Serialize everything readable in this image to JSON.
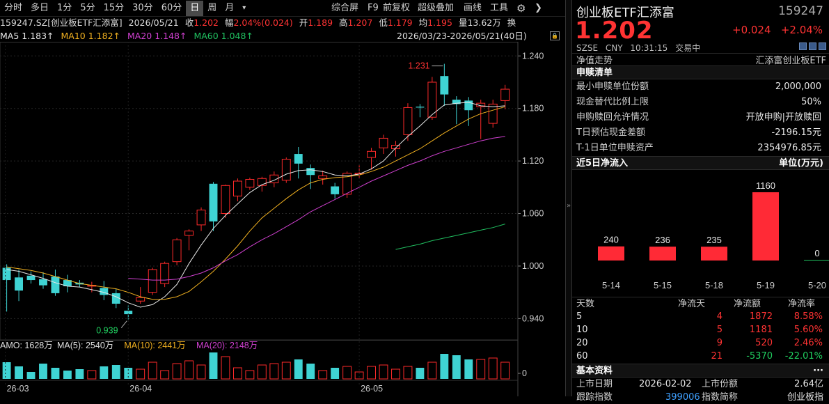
{
  "toolbar": {
    "periods": [
      "分时",
      "多日",
      "1分",
      "5分",
      "15分",
      "30分",
      "60分",
      "日",
      "周",
      "月"
    ],
    "active": "日",
    "more": "▾",
    "right_items": [
      "综合屏",
      "F9",
      "前复权",
      "超级叠加",
      "画线",
      "工具"
    ],
    "gear": "⚙",
    "chevron": "❯"
  },
  "info": {
    "symbol": "159247.SZ[创业板ETF汇添富]",
    "date": "2026/05/21",
    "close_label": "收",
    "close": "1.202",
    "range_label": "幅",
    "range": "2.04%(0.024)",
    "open_label": "开",
    "open": "1.189",
    "high_label": "高",
    "high": "1.207",
    "low_label": "低",
    "low": "1.179",
    "avg_label": "均",
    "avg": "1.195",
    "vol_label": "量",
    "vol": "13.62万",
    "turn_label": "换"
  },
  "ma": {
    "ma5": "MA5 1.183↑",
    "ma10": "MA10 1.182↑",
    "ma20": "MA20 1.148↑",
    "ma60": "MA60 1.048↑",
    "date_range": "2026/03/23-2026/05/21(40日)"
  },
  "amo": {
    "label": "AMO: 1628万",
    "ma5": "MA(5): 2540万",
    "ma10": "MA(10): 2441万",
    "ma20": "MA(20): 2148万"
  },
  "chart_data": {
    "type": "candlestick",
    "y_ticks": [
      "1.240",
      "1.180",
      "1.120",
      "1.060",
      "1.000",
      "0.940"
    ],
    "y_range": [
      0.922,
      1.245
    ],
    "vol_tick": "0",
    "x_ticks": [
      "26-03",
      "26-04",
      "26-05"
    ],
    "high_label": "1.231",
    "low_label": "0.939",
    "candles": [
      {
        "o": 0.998,
        "h": 1.002,
        "c": 0.984,
        "l": 0.948
      },
      {
        "o": 0.987,
        "h": 0.996,
        "c": 0.972,
        "l": 0.96
      },
      {
        "o": 0.989,
        "h": 0.994,
        "c": 0.984,
        "l": 0.98
      },
      {
        "o": 0.985,
        "h": 0.993,
        "c": 0.978,
        "l": 0.974
      },
      {
        "o": 0.988,
        "h": 0.996,
        "c": 0.969,
        "l": 0.966
      },
      {
        "o": 0.984,
        "h": 0.99,
        "c": 0.977,
        "l": 0.97
      },
      {
        "o": 0.981,
        "h": 0.984,
        "c": 0.979,
        "l": 0.976
      },
      {
        "o": 0.977,
        "h": 0.982,
        "c": 0.978,
        "l": 0.97
      },
      {
        "o": 0.975,
        "h": 0.983,
        "c": 0.967,
        "l": 0.961
      },
      {
        "o": 0.969,
        "h": 0.974,
        "c": 0.957,
        "l": 0.952
      },
      {
        "o": 0.949,
        "h": 0.955,
        "c": 0.945,
        "l": 0.939
      },
      {
        "o": 0.96,
        "h": 0.976,
        "c": 0.964,
        "l": 0.957
      },
      {
        "o": 0.97,
        "h": 0.998,
        "c": 0.996,
        "l": 0.967
      },
      {
        "o": 0.98,
        "h": 1.005,
        "c": 1.003,
        "l": 0.976
      },
      {
        "o": 1.005,
        "h": 1.032,
        "c": 1.03,
        "l": 1.001
      },
      {
        "o": 1.035,
        "h": 1.042,
        "c": 1.04,
        "l": 1.018
      },
      {
        "o": 1.047,
        "h": 1.067,
        "c": 1.064,
        "l": 1.04
      },
      {
        "o": 1.094,
        "h": 1.096,
        "c": 1.051,
        "l": 1.04
      },
      {
        "o": 1.06,
        "h": 1.093,
        "c": 1.092,
        "l": 1.055
      },
      {
        "o": 1.08,
        "h": 1.1,
        "c": 1.097,
        "l": 1.074
      },
      {
        "o": 1.09,
        "h": 1.101,
        "c": 1.099,
        "l": 1.087
      },
      {
        "o": 1.092,
        "h": 1.102,
        "c": 1.1,
        "l": 1.085
      },
      {
        "o": 1.095,
        "h": 1.108,
        "c": 1.104,
        "l": 1.09
      },
      {
        "o": 1.098,
        "h": 1.124,
        "c": 1.122,
        "l": 1.095
      },
      {
        "o": 1.128,
        "h": 1.136,
        "c": 1.117,
        "l": 1.1
      },
      {
        "o": 1.112,
        "h": 1.116,
        "c": 1.104,
        "l": 1.088
      },
      {
        "o": 1.1,
        "h": 1.109,
        "c": 1.103,
        "l": 1.093
      },
      {
        "o": 1.091,
        "h": 1.095,
        "c": 1.082,
        "l": 1.077
      },
      {
        "o": 1.082,
        "h": 1.108,
        "c": 1.106,
        "l": 1.078
      },
      {
        "o": 1.105,
        "h": 1.115,
        "c": 1.106,
        "l": 1.1
      },
      {
        "o": 1.124,
        "h": 1.135,
        "c": 1.131,
        "l": 1.11
      },
      {
        "o": 1.135,
        "h": 1.15,
        "c": 1.146,
        "l": 1.128
      },
      {
        "o": 1.134,
        "h": 1.143,
        "c": 1.138,
        "l": 1.125
      },
      {
        "o": 1.15,
        "h": 1.186,
        "c": 1.181,
        "l": 1.143
      },
      {
        "o": 1.182,
        "h": 1.185,
        "c": 1.181,
        "l": 1.17
      },
      {
        "o": 1.17,
        "h": 1.216,
        "c": 1.21,
        "l": 1.167
      },
      {
        "o": 1.217,
        "h": 1.231,
        "c": 1.196,
        "l": 1.183
      },
      {
        "o": 1.19,
        "h": 1.194,
        "c": 1.185,
        "l": 1.162
      },
      {
        "o": 1.189,
        "h": 1.193,
        "c": 1.178,
        "l": 1.16
      },
      {
        "o": 1.182,
        "h": 1.19,
        "c": 1.186,
        "l": 1.145
      },
      {
        "o": 1.163,
        "h": 1.19,
        "c": 1.185,
        "l": 1.158
      },
      {
        "o": 1.189,
        "h": 1.207,
        "c": 1.202,
        "l": 1.179
      }
    ],
    "ma5": [
      0.996,
      0.994,
      0.99,
      0.986,
      0.981,
      0.977,
      0.976,
      0.973,
      0.97,
      0.965,
      0.958,
      0.953,
      0.956,
      0.965,
      0.979,
      1.003,
      1.024,
      1.043,
      1.058,
      1.071,
      1.084,
      1.093,
      1.098,
      1.105,
      1.109,
      1.11,
      1.108,
      1.104,
      1.103,
      1.105,
      1.111,
      1.12,
      1.135,
      1.148,
      1.16,
      1.173,
      1.184,
      1.186,
      1.187,
      1.183,
      1.182,
      1.183
    ],
    "ma10": [
      0.999,
      0.997,
      0.995,
      0.992,
      0.988,
      0.984,
      0.98,
      0.978,
      0.976,
      0.974,
      0.97,
      0.965,
      0.962,
      0.962,
      0.965,
      0.971,
      0.982,
      0.994,
      1.008,
      1.023,
      1.04,
      1.055,
      1.066,
      1.077,
      1.087,
      1.095,
      1.099,
      1.101,
      1.102,
      1.104,
      1.108,
      1.113,
      1.12,
      1.127,
      1.134,
      1.143,
      1.152,
      1.16,
      1.168,
      1.174,
      1.178,
      1.182
    ],
    "ma20": [
      null,
      null,
      null,
      null,
      null,
      null,
      null,
      null,
      null,
      null,
      0.986,
      0.985,
      0.984,
      0.984,
      0.985,
      0.988,
      0.992,
      0.998,
      1.006,
      1.013,
      1.022,
      1.03,
      1.037,
      1.045,
      1.053,
      1.062,
      1.069,
      1.076,
      1.083,
      1.09,
      1.097,
      1.103,
      1.109,
      1.115,
      1.12,
      1.126,
      1.131,
      1.135,
      1.139,
      1.143,
      1.146,
      1.148
    ],
    "ma60": [
      null,
      null,
      null,
      null,
      null,
      null,
      null,
      null,
      null,
      null,
      null,
      null,
      null,
      null,
      null,
      null,
      null,
      null,
      null,
      null,
      null,
      null,
      null,
      null,
      null,
      null,
      null,
      null,
      null,
      null,
      null,
      null,
      1.019,
      1.022,
      1.025,
      1.029,
      1.032,
      1.035,
      1.038,
      1.041,
      1.044,
      1.048
    ],
    "volumes": [
      60,
      45,
      25,
      55,
      40,
      30,
      35,
      30,
      45,
      50,
      40,
      35,
      60,
      30,
      55,
      65,
      50,
      95,
      80,
      40,
      30,
      50,
      55,
      60,
      70,
      55,
      30,
      40,
      45,
      25,
      45,
      50,
      35,
      45,
      40,
      60,
      90,
      85,
      70,
      70,
      75,
      60
    ]
  },
  "panel": {
    "title": "创业板ETF汇添富",
    "code": "159247",
    "price": "1.202",
    "change": "+0.024",
    "change_pct": "+2.04%",
    "exchange": "SZSE",
    "currency": "CNY",
    "time": "10:31:15",
    "status": "交易中",
    "nav_label": "净值走势",
    "nav_name": "汇添富创业板ETF",
    "sub_title": "申赎清单",
    "sub_rows": [
      {
        "k": "最小申赎单位份额",
        "v": "2,000,000"
      },
      {
        "k": "现金替代比例上限",
        "v": "50%"
      },
      {
        "k": "申购赎回允许情况",
        "v": "开放申购|开放赎回"
      },
      {
        "k": "T日预估现金差额",
        "v": "-2196.15元"
      },
      {
        "k": "T-1日单位申赎资产",
        "v": "2354976.85元"
      }
    ],
    "flow_title": "近5日净流入",
    "flow_unit": "单位(万元)",
    "flow_labels": [
      "240",
      "236",
      "235",
      "1160",
      "0"
    ],
    "flow_dates": [
      "5-14",
      "5-15",
      "5-18",
      "5-19",
      "5-20"
    ],
    "flow_values": [
      240,
      236,
      235,
      1160,
      0
    ],
    "table_head": [
      "天数",
      "净流天",
      "净流额",
      "净流率"
    ],
    "table_rows": [
      [
        "5",
        "4",
        "1872",
        "8.58%"
      ],
      [
        "10",
        "5",
        "1181",
        "5.60%"
      ],
      [
        "20",
        "9",
        "520",
        "2.46%"
      ],
      [
        "60",
        "21",
        "-5370",
        "-22.01%"
      ]
    ],
    "basic_title": "基本资料",
    "basic_more": "···",
    "basic_rows": [
      {
        "k": "上市日期",
        "v": "2026-02-02",
        "k2": "上市份额",
        "v2": "2.64亿"
      },
      {
        "k": "跟踪指数",
        "v": "399006",
        "k2": "指数简称",
        "v2": "创业板指"
      }
    ]
  }
}
